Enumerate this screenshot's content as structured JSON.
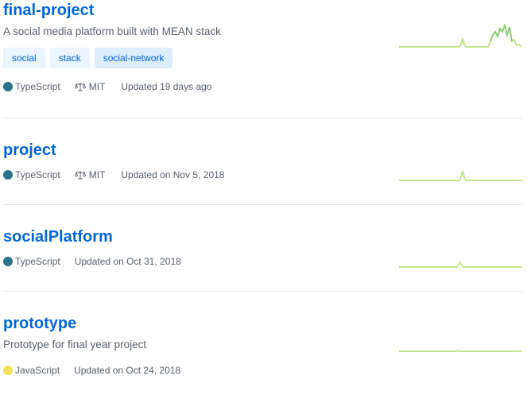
{
  "repos": [
    {
      "name": "final-project",
      "description": "A social media platform built with MEAN stack",
      "topics": [
        "social",
        "stack",
        "social-network"
      ],
      "language": "TypeScript",
      "language_color": "#2b7489",
      "license": "MIT",
      "updated": "Updated 19 days ago"
    },
    {
      "name": "project",
      "language": "TypeScript",
      "language_color": "#2b7489",
      "license": "MIT",
      "updated": "Updated on Nov 5, 2018"
    },
    {
      "name": "socialPlatform",
      "language": "TypeScript",
      "language_color": "#2b7489",
      "updated": "Updated on Oct 31, 2018"
    },
    {
      "name": "prototype",
      "description": "Prototype for final year project",
      "language": "JavaScript",
      "language_color": "#f1e05a",
      "updated": "Updated on Oct 24, 2018"
    }
  ],
  "colors": {
    "link": "#0366d6",
    "spark_light": "#c6e48b",
    "spark_dark": "#7bc96f"
  }
}
